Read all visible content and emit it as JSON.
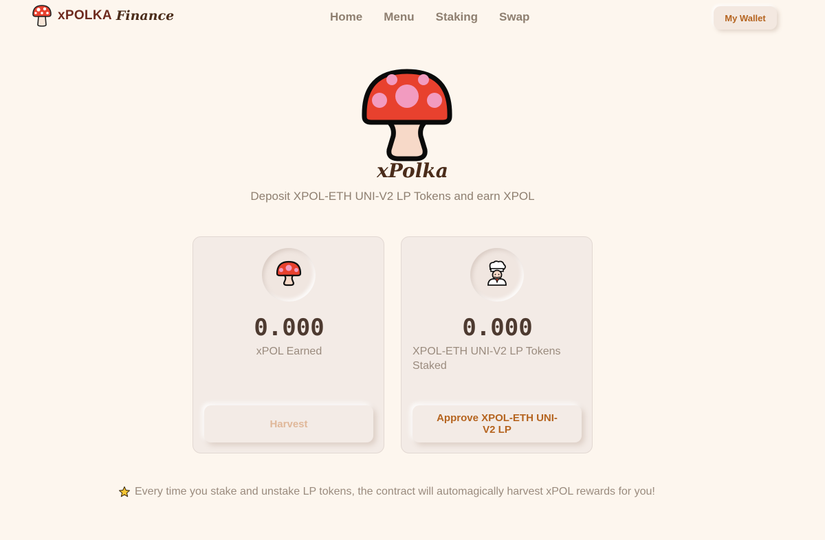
{
  "header": {
    "brand_name": "xPOLKA",
    "brand_sub": "Finance",
    "nav": [
      "Home",
      "Menu",
      "Staking",
      "Swap"
    ],
    "wallet_button": "My Wallet"
  },
  "hero": {
    "logo_word": "xPolka",
    "subtitle": "Deposit XPOL-ETH UNI-V2 LP Tokens and earn XPOL"
  },
  "cards": [
    {
      "icon": "mushroom-icon",
      "value": "0.000",
      "label": "xPOL Earned",
      "button": "Harvest"
    },
    {
      "icon": "chef-icon",
      "value": "0.000",
      "label": "XPOL-ETH UNI-V2 LP Tokens Staked",
      "button": "Approve XPOL-ETH UNI-V2 LP"
    }
  ],
  "tip": {
    "icon": "star-icon",
    "text": "Every time you stake and unstake LP tokens, the contract will automagically harvest xPOL rewards for you!"
  },
  "colors": {
    "background": "#fdf6ee",
    "accent": "#b5641f",
    "mushroom_cap": "#e8412e",
    "mushroom_spots": "#f29bc0"
  }
}
